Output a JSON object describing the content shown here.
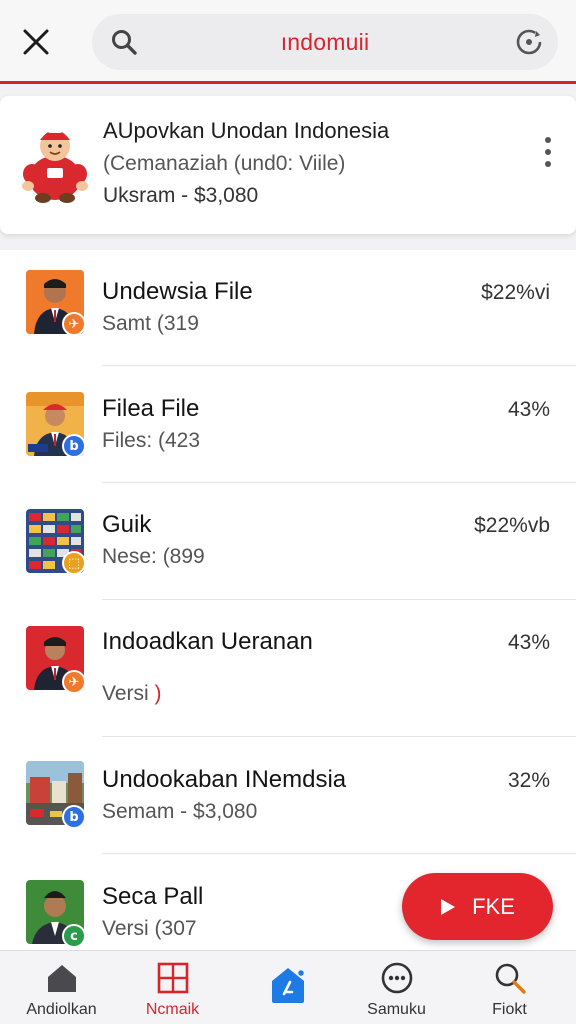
{
  "search": {
    "query": "ındomuii"
  },
  "featured": {
    "title": "AUpovkan Unodan Indonesia",
    "subtitle": "(Cemanaziah (und0: Viile)",
    "price_line": "Uksram - $3,080"
  },
  "list": [
    {
      "title": "Undewsia File",
      "subtitle": "Samt (319",
      "value": "$22%vi",
      "badge": "✈",
      "badge_color": "#f07a2b"
    },
    {
      "title": "Filea File",
      "subtitle": "Files: (423",
      "value": "43%",
      "badge": "b",
      "badge_color": "#2f6fe4"
    },
    {
      "title": "Guik",
      "subtitle": "Nese: (899",
      "value": "$22%vb",
      "badge": "⬚",
      "badge_color": "#e8a21f"
    },
    {
      "title": "Indoadkan Ueranan",
      "subtitle": "Versi",
      "subtitle_accent": ")",
      "value": "43%",
      "badge": "✈",
      "badge_color": "#f07a2b"
    },
    {
      "title": "Undookaban INemdsia",
      "subtitle": "Semam - $3,080",
      "value": "32%",
      "badge": "b",
      "badge_color": "#2f6fe4"
    },
    {
      "title": "Seca Pall",
      "subtitle": "Versi (307",
      "value": "",
      "badge": "c",
      "badge_color": "#2a9d4a"
    }
  ],
  "fab": {
    "label": "FKE"
  },
  "bottom_nav": {
    "items": [
      {
        "label": "Andiolkan",
        "icon": "home-icon"
      },
      {
        "label": "Ncmaik",
        "icon": "grid-icon",
        "active": true
      },
      {
        "label": "",
        "icon": "upload-icon"
      },
      {
        "label": "Samuku",
        "icon": "chat-icon"
      },
      {
        "label": "Fiokt",
        "icon": "search-icon"
      }
    ]
  },
  "colors": {
    "accent": "#d8242c",
    "badge_orange": "#f07a2b",
    "badge_blue": "#2f6fe4",
    "badge_yellow": "#e8a21f",
    "badge_green": "#2a9d4a",
    "nav_active_blue": "#1e7be6"
  }
}
